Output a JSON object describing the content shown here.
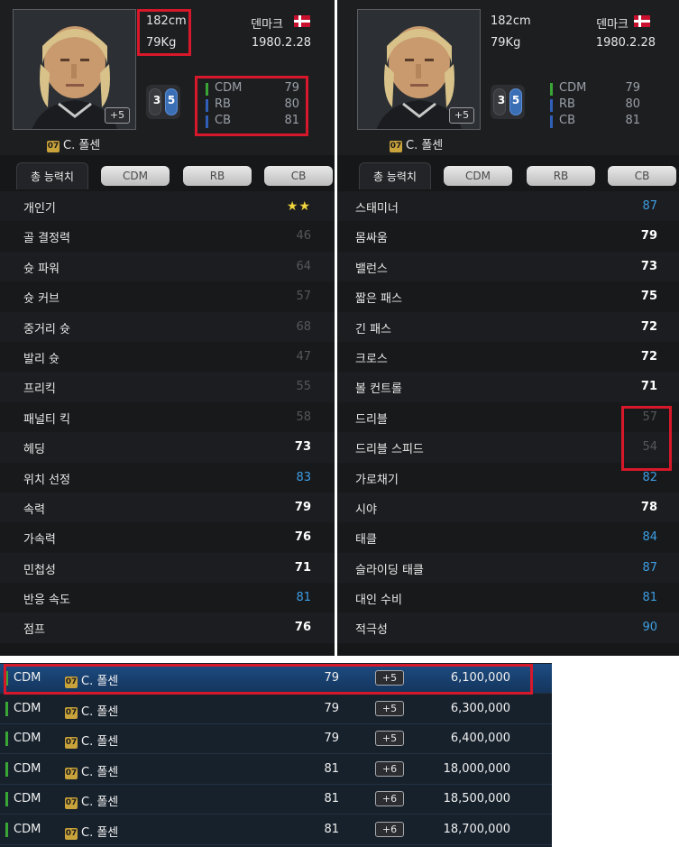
{
  "player": {
    "name": "C. 폴센",
    "season": "07",
    "height": "182cm",
    "weight": "79Kg",
    "country": "덴마크",
    "birth": "1980.2.28",
    "photo_boost": "+5",
    "weak_foot_left": "3",
    "weak_foot_right": "5",
    "positions": [
      {
        "name": "CDM",
        "value": "79",
        "color": "#3aa537"
      },
      {
        "name": "RB",
        "value": "80",
        "color": "#2f5fb8"
      },
      {
        "name": "CB",
        "value": "81",
        "color": "#2f5fb8"
      }
    ]
  },
  "tabs": [
    "총 능력치",
    "CDM",
    "RB",
    "CB"
  ],
  "left_stats": [
    {
      "label": "개인기",
      "value": "★★",
      "style": "stars"
    },
    {
      "label": "골 결정력",
      "value": "46",
      "style": "dim"
    },
    {
      "label": "슛 파워",
      "value": "64",
      "style": "dim"
    },
    {
      "label": "슛 커브",
      "value": "57",
      "style": "dim"
    },
    {
      "label": "중거리 슛",
      "value": "68",
      "style": "dim"
    },
    {
      "label": "발리 슛",
      "value": "47",
      "style": "dim"
    },
    {
      "label": "프리킥",
      "value": "55",
      "style": "dim"
    },
    {
      "label": "패널티 킥",
      "value": "58",
      "style": "dim"
    },
    {
      "label": "헤딩",
      "value": "73",
      "style": "white"
    },
    {
      "label": "위치 선정",
      "value": "83",
      "style": "blue"
    },
    {
      "label": "속력",
      "value": "79",
      "style": "white"
    },
    {
      "label": "가속력",
      "value": "76",
      "style": "white"
    },
    {
      "label": "민첩성",
      "value": "71",
      "style": "white"
    },
    {
      "label": "반응 속도",
      "value": "81",
      "style": "blue"
    },
    {
      "label": "점프",
      "value": "76",
      "style": "white"
    }
  ],
  "right_stats": [
    {
      "label": "스태미너",
      "value": "87",
      "style": "blue"
    },
    {
      "label": "몸싸움",
      "value": "79",
      "style": "white"
    },
    {
      "label": "밸런스",
      "value": "73",
      "style": "white"
    },
    {
      "label": "짧은 패스",
      "value": "75",
      "style": "white"
    },
    {
      "label": "긴 패스",
      "value": "72",
      "style": "white"
    },
    {
      "label": "크로스",
      "value": "72",
      "style": "white"
    },
    {
      "label": "볼 컨트롤",
      "value": "71",
      "style": "white"
    },
    {
      "label": "드리블",
      "value": "57",
      "style": "dim"
    },
    {
      "label": "드리블 스피드",
      "value": "54",
      "style": "dim"
    },
    {
      "label": "가로채기",
      "value": "82",
      "style": "blue"
    },
    {
      "label": "시야",
      "value": "78",
      "style": "white"
    },
    {
      "label": "태클",
      "value": "84",
      "style": "blue"
    },
    {
      "label": "슬라이딩 태클",
      "value": "87",
      "style": "blue"
    },
    {
      "label": "대인 수비",
      "value": "81",
      "style": "blue"
    },
    {
      "label": "적극성",
      "value": "90",
      "style": "blue"
    }
  ],
  "market": [
    {
      "pos": "CDM",
      "season": "07",
      "name": "C. 폴센",
      "ovr": "79",
      "boost": "+5",
      "price": "6,100,000",
      "selected": true
    },
    {
      "pos": "CDM",
      "season": "07",
      "name": "C. 폴센",
      "ovr": "79",
      "boost": "+5",
      "price": "6,300,000",
      "selected": false
    },
    {
      "pos": "CDM",
      "season": "07",
      "name": "C. 폴센",
      "ovr": "79",
      "boost": "+5",
      "price": "6,400,000",
      "selected": false
    },
    {
      "pos": "CDM",
      "season": "07",
      "name": "C. 폴센",
      "ovr": "81",
      "boost": "+6",
      "price": "18,000,000",
      "selected": false
    },
    {
      "pos": "CDM",
      "season": "07",
      "name": "C. 폴센",
      "ovr": "81",
      "boost": "+6",
      "price": "18,500,000",
      "selected": false
    },
    {
      "pos": "CDM",
      "season": "07",
      "name": "C. 폴센",
      "ovr": "81",
      "boost": "+6",
      "price": "18,700,000",
      "selected": false
    }
  ],
  "colors": {
    "highlight": "#d7182a",
    "stat_blue": "#3d9ee3",
    "pos_green": "#3aa537",
    "pos_blue": "#2f5fb8"
  }
}
